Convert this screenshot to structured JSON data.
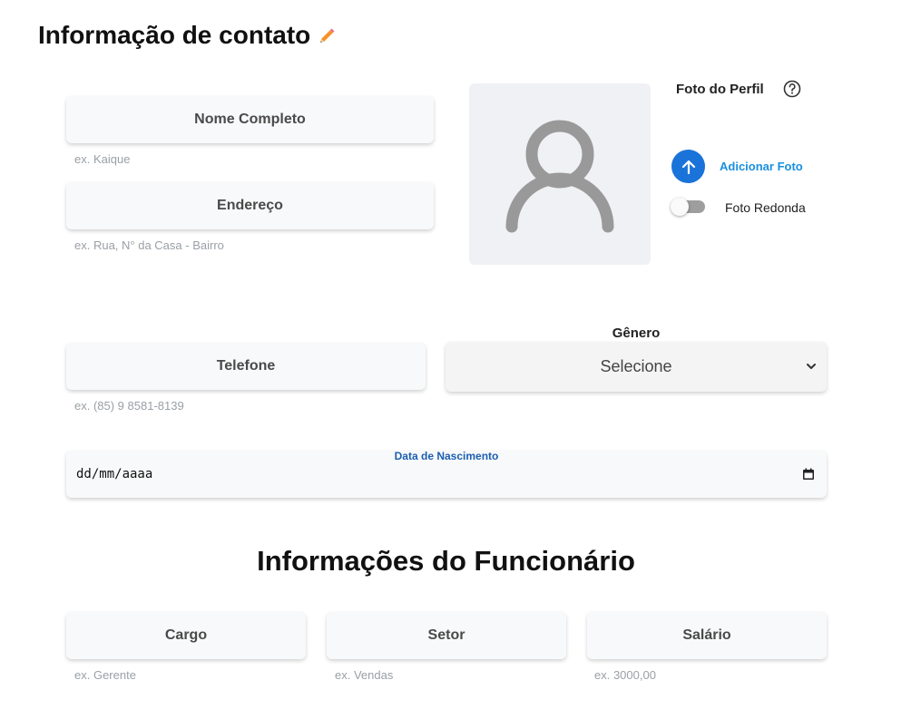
{
  "contact": {
    "title": "Informação de contato",
    "full_name": {
      "label": "Nome Completo",
      "hint": "ex. Kaique"
    },
    "address": {
      "label": "Endereço",
      "hint": "ex. Rua, N° da Casa - Bairro"
    },
    "phone": {
      "label": "Telefone",
      "hint": "ex. (85) 9 8581-8139"
    },
    "photo": {
      "label": "Foto do Perfil",
      "upload_label": "Adicionar Foto",
      "round_toggle_label": "Foto Redonda",
      "round_toggle_on": false
    },
    "gender": {
      "label": "Gênero",
      "selected": "Selecione"
    },
    "birth_date": {
      "label": "Data de Nascimento",
      "value": "dd/mm/aaaa"
    }
  },
  "employee": {
    "title": "Informações do Funcionário",
    "role": {
      "label": "Cargo",
      "hint": "ex. Gerente"
    },
    "sector": {
      "label": "Setor",
      "hint": "ex. Vendas"
    },
    "salary": {
      "label": "Salário",
      "hint": "ex. 3000,00"
    }
  },
  "colors": {
    "accent": "#1a73d9",
    "link": "#1a8fe0",
    "edit_icon": "#f0802a"
  },
  "icons": {
    "title_edit": "pencil-icon",
    "help": "help-circle-icon",
    "upload": "arrow-up-icon",
    "avatar": "user-icon",
    "select": "chevron-down-icon",
    "date": "calendar-icon"
  }
}
